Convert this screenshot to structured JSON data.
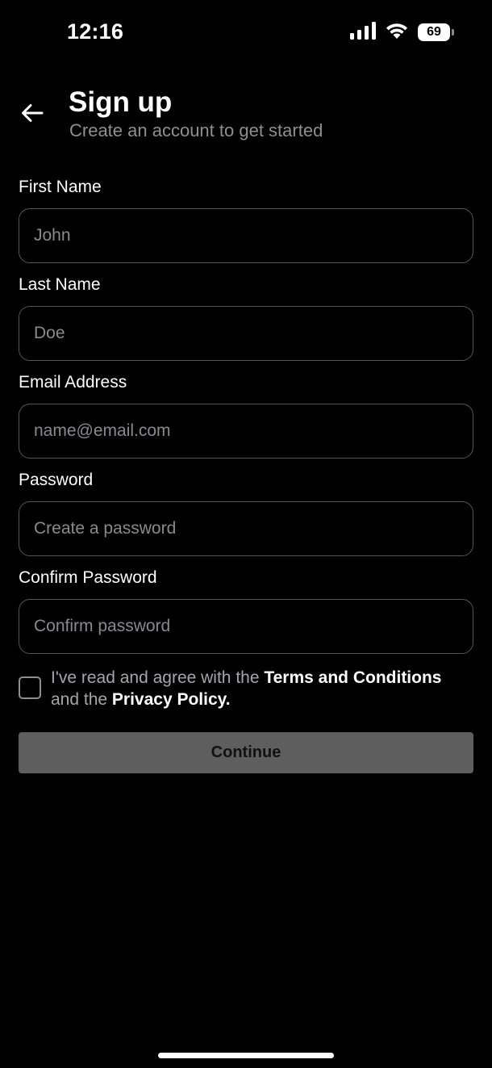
{
  "status_bar": {
    "time": "12:16",
    "battery_level": "69",
    "icons": [
      "signal-icon",
      "wifi-icon",
      "battery-icon"
    ]
  },
  "header": {
    "back_icon": "arrow-left-icon",
    "title": "Sign up",
    "subtitle": "Create an account to get started"
  },
  "form": {
    "fields": [
      {
        "label": "First Name",
        "placeholder": "John",
        "value": ""
      },
      {
        "label": "Last Name",
        "placeholder": "Doe",
        "value": ""
      },
      {
        "label": "Email Address",
        "placeholder": "name@email.com",
        "value": ""
      },
      {
        "label": "Password",
        "placeholder": "Create a password",
        "value": ""
      },
      {
        "label": "Confirm Password",
        "placeholder": "Confirm password",
        "value": ""
      }
    ],
    "agreement": {
      "checked": false,
      "text_before": "I've read and agree with the ",
      "terms_link": "Terms and Conditions",
      "text_middle": " and the ",
      "privacy_link": "Privacy Policy."
    },
    "continue_label": "Continue"
  },
  "colors": {
    "background": "#000000",
    "text": "#ffffff",
    "muted_text": "#8e8e93",
    "input_border": "#555558",
    "button_disabled_bg": "#5e5e5e"
  }
}
